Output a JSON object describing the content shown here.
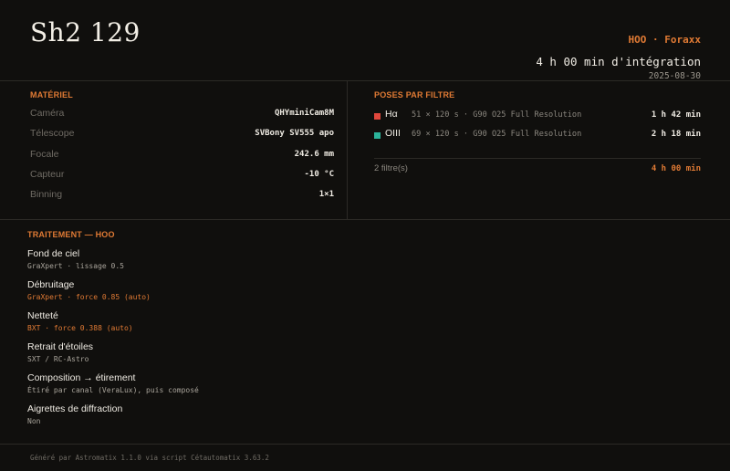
{
  "header": {
    "title": "Sh2 129",
    "tag": "HOO · Foraxx",
    "integration": "4 h 00 min d'intégration",
    "date": "2025-08-30"
  },
  "materiel": {
    "title": "MATÉRIEL",
    "rows": [
      {
        "label": "Caméra",
        "value": "QHYminiCam8M"
      },
      {
        "label": "Télescope",
        "value": "SVBony SV555 apo"
      },
      {
        "label": "Focale",
        "value": "242.6 mm"
      },
      {
        "label": "Capteur",
        "value": "-10 °C"
      },
      {
        "label": "Binning",
        "value": "1×1"
      }
    ]
  },
  "poses": {
    "title": "POSES PAR FILTRE",
    "rows": [
      {
        "filter": "Hα",
        "detail": "51 × 120 s · G90 O25 Full Resolution",
        "duration": "1 h 42 min",
        "color": "#e0473c"
      },
      {
        "filter": "OIII",
        "detail": "69 × 120 s · G90 O25 Full Resolution",
        "duration": "2 h 18 min",
        "color": "#2bb39a"
      }
    ],
    "count": "2 filtre(s)",
    "total": "4 h 00 min"
  },
  "traitement": {
    "title": "TRAITEMENT — HOO",
    "steps": [
      {
        "name": "Fond de ciel",
        "desc": "GraXpert · lissage 0.5",
        "accent": false
      },
      {
        "name": "Débruitage",
        "desc": "GraXpert · force 0.85 (auto)",
        "accent": true
      },
      {
        "name": "Netteté",
        "desc": "BXT · force 0.388 (auto)",
        "accent": true
      },
      {
        "name": "Retrait d'étoiles",
        "desc": "SXT / RC-Astro",
        "accent": false
      },
      {
        "name": "Composition → étirement",
        "desc": "Étiré par canal (VeraLux), puis composé",
        "accent": false
      },
      {
        "name": "Aigrettes de diffraction",
        "desc": "Non",
        "accent": false
      }
    ]
  },
  "footer": {
    "text": "Généré par Astromatix 1.1.0 via script Cétautomatix 3.63.2"
  },
  "colors": {
    "background": "#100f0d",
    "accent": "#e07a34",
    "ha": "#e0473c",
    "oiii": "#2bb39a"
  }
}
